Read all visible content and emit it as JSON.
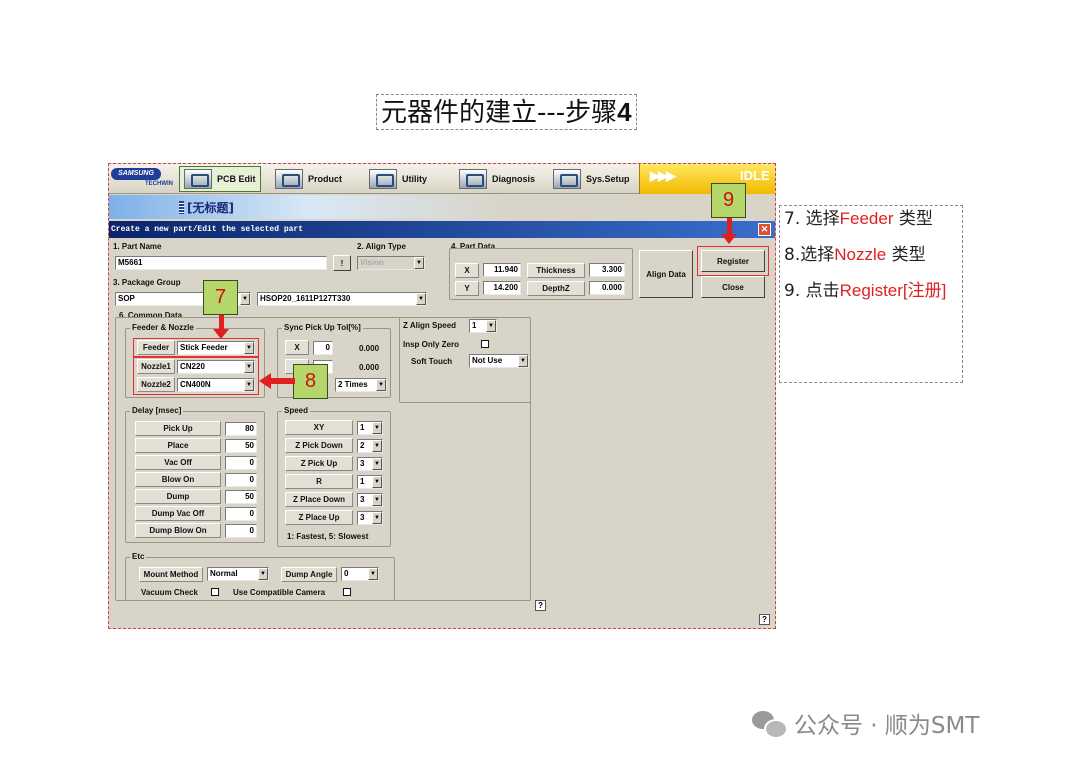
{
  "slide": {
    "title_prefix": "元器件的建立---步骤",
    "title_num": "4"
  },
  "app": {
    "brand": "SAMSUNG",
    "brand_sub": "TECHWIN",
    "tabs": [
      "PCB Edit",
      "Product",
      "Utility",
      "Diagnosis",
      "Sys.Setup"
    ],
    "status_arrows": "▶▶▶",
    "status": "IDLE",
    "doc_title": "[无标题]"
  },
  "dialog": {
    "title": "Create a new part/Edit the selected part",
    "part_name_label": "1. Part Name",
    "part_name": "M5661",
    "part_name_btn": "!",
    "align_type_label": "2. Align Type",
    "align_type": "Vision",
    "package_group_label": "3. Package Group",
    "package_group": "SOP",
    "package_name": "HSOP20_1611P127T330",
    "part_data_label": "4. Part Data",
    "x_label": "X",
    "x_value": "11.940",
    "thickness_label": "Thickness",
    "thickness_value": "3.300",
    "y_label": "Y",
    "y_value": "14.200",
    "depthz_label": "DepthZ",
    "depthz_value": "0.000",
    "align_data_btn": "Align Data",
    "register_btn": "Register",
    "close_btn": "Close",
    "common_label": "6. Common Data",
    "feeder_nozzle_label": "Feeder & Nozzle",
    "feeder_label": "Feeder",
    "feeder_value": "Stick Feeder",
    "nozzle1_label": "Nozzle1",
    "nozzle1_value": "CN220",
    "nozzle2_label": "Nozzle2",
    "nozzle2_value": "CN400N",
    "sync_label": "Sync Pick Up Tol[%]",
    "sync_x_label": "X",
    "sync_x_value": "0",
    "sync_x_result": "0.000",
    "sync_y_result": "0.000",
    "sync_times": "2 Times",
    "z_align_speed_label": "Z Align Speed",
    "z_align_speed": "1",
    "insp_only_zero_label": "Insp Only Zero",
    "soft_touch_label": "Soft Touch",
    "soft_touch_value": "Not Use",
    "delay_label": "Delay [msec]",
    "delays": [
      {
        "label": "Pick Up",
        "value": "80"
      },
      {
        "label": "Place",
        "value": "50"
      },
      {
        "label": "Vac Off",
        "value": "0"
      },
      {
        "label": "Blow On",
        "value": "0"
      },
      {
        "label": "Dump",
        "value": "50"
      },
      {
        "label": "Dump Vac Off",
        "value": "0"
      },
      {
        "label": "Dump Blow On",
        "value": "0"
      }
    ],
    "speed_label": "Speed",
    "speeds": [
      {
        "label": "XY",
        "value": "1"
      },
      {
        "label": "Z Pick Down",
        "value": "2"
      },
      {
        "label": "Z Pick Up",
        "value": "3"
      },
      {
        "label": "R",
        "value": "1"
      },
      {
        "label": "Z Place Down",
        "value": "3"
      },
      {
        "label": "Z Place Up",
        "value": "3"
      }
    ],
    "speed_note": "1: Fastest, 5: Slowest",
    "etc_label": "Etc",
    "mount_method_label": "Mount Method",
    "mount_method": "Normal",
    "dump_angle_label": "Dump Angle",
    "dump_angle": "0",
    "vacuum_check_label": "Vacuum Check",
    "compatible_camera_label": "Use Compatible Camera",
    "help": "?"
  },
  "markers": {
    "m7": "7",
    "m8": "8",
    "m9": "9"
  },
  "notes": [
    {
      "pre": "7. 选择",
      "red": "Feeder",
      "post": " 类型"
    },
    {
      "pre": "8.选择",
      "red": "Nozzle",
      "post": " 类型"
    },
    {
      "pre": "9. 点击",
      "red": "Register[注册]",
      "post": ""
    }
  ],
  "watermark": "公众号 · 顺为SMT",
  "colors": {
    "highlight": "#e53030",
    "marker_fill": "#b4d66a",
    "dialog_title": "#0a246a",
    "window_face": "#d8d4c8"
  }
}
